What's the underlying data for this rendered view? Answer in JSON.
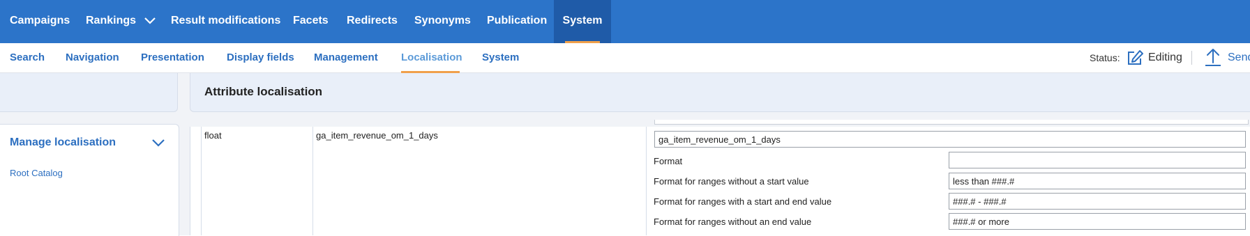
{
  "top_nav": {
    "items": [
      {
        "label": "Campaigns"
      },
      {
        "label": "Rankings",
        "has_dropdown": true
      },
      {
        "label": "Result modifications"
      },
      {
        "label": "Facets"
      },
      {
        "label": "Redirects"
      },
      {
        "label": "Synonyms"
      },
      {
        "label": "Publication"
      },
      {
        "label": "System",
        "active": true
      }
    ]
  },
  "sub_nav": {
    "items": [
      {
        "label": "Search"
      },
      {
        "label": "Navigation"
      },
      {
        "label": "Presentation"
      },
      {
        "label": "Display fields"
      },
      {
        "label": "Management"
      },
      {
        "label": "Localisation",
        "active": true
      },
      {
        "label": "System"
      }
    ]
  },
  "status": {
    "label": "Status:",
    "value": "Editing",
    "icon": "edit-icon",
    "send_label": "Send",
    "send_icon": "upload-icon"
  },
  "main": {
    "title": "Attribute localisation"
  },
  "sidebar": {
    "title": "Manage localisation",
    "link": "Root Catalog"
  },
  "row": {
    "type": "float",
    "attribute": "ga_item_revenue_om_1_days",
    "name_value": "ga_item_revenue_om_1_days",
    "fields": [
      {
        "label": "Format",
        "value": ""
      },
      {
        "label": "Format for ranges without a start value",
        "value": "less than ###.#"
      },
      {
        "label": "Format for ranges with a start and end value",
        "value": "###.# - ###.#"
      },
      {
        "label": "Format for ranges without an end value",
        "value": "###.# or more"
      }
    ]
  },
  "colors": {
    "top_nav_bg": "#2c74c9",
    "top_nav_active_bg": "#1f5ba8",
    "accent_orange": "#f0a04b",
    "link_blue": "#2c6fc0"
  }
}
